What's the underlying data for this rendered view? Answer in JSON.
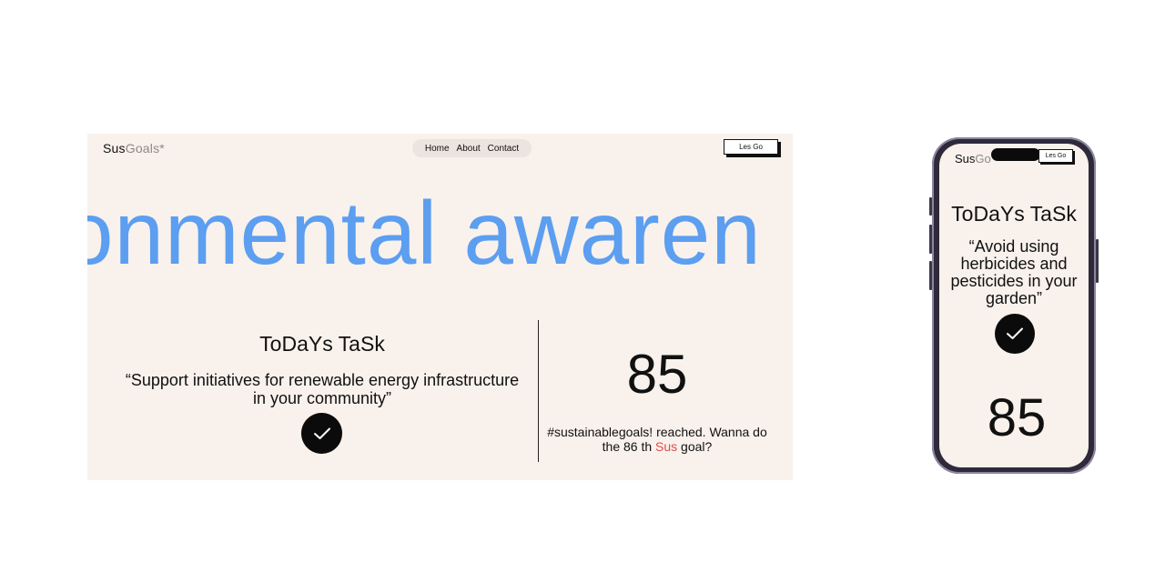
{
  "desktop": {
    "logo": {
      "bold": "Sus",
      "light": "Goals*"
    },
    "nav": [
      "Home",
      "About",
      "Contact"
    ],
    "cta_label": "Les Go",
    "marquee_text": "onmental awaren",
    "task_title": "ToDaYs TaSk",
    "task_text": "“Support initiatives for renewable energy infrastructure in your community”",
    "counter": "85",
    "counter_text_pre": "#sustainablegoals! reached. Wanna do the 86 th ",
    "counter_text_highlight": "Sus",
    "counter_text_post": " goal?"
  },
  "mobile": {
    "logo": {
      "bold": "Sus",
      "light": "Go"
    },
    "cta_label": "Les Go",
    "task_title": "ToDaYs TaSk",
    "task_text": "“Avoid using herbicides and pesticides in your garden”",
    "counter": "85"
  },
  "colors": {
    "background": "#f8f1ec",
    "accent_blue": "#5c9ef0",
    "highlight_red": "#e24b4b",
    "dark": "#0b0b0b"
  },
  "icons": {
    "check": "check-icon"
  }
}
